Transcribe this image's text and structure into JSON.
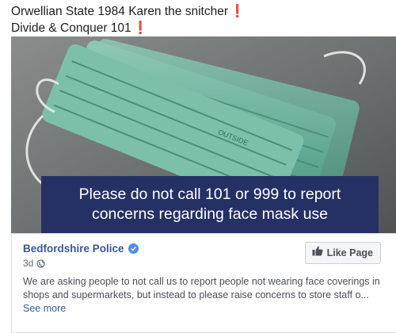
{
  "post": {
    "line1": "Orwellian State 1984 Karen the snitcher",
    "line2": "Divide & Conquer 101",
    "emoji": "❗"
  },
  "image": {
    "mask_print": "OUTSIDE",
    "caption_line1": "Please do not call 101 or 999 to report",
    "caption_line2": "concerns regarding face mask use"
  },
  "card": {
    "page_name": "Bedfordshire Police",
    "time": "3d",
    "like_button": "Like Page",
    "description_line1": "We are asking people to not call us to report people not wearing face coverings in",
    "description_line2": "shops and supermarkets, but instead to please raise concerns to store staff o...",
    "see_more": "See more"
  },
  "colors": {
    "caption_bg": "#253065",
    "link": "#385898",
    "mask": "#6fb4a0",
    "verified": "#4a8ef0"
  },
  "icons": [
    "verified-badge-icon",
    "globe-icon",
    "thumbs-up-icon",
    "exclamation-icon"
  ]
}
